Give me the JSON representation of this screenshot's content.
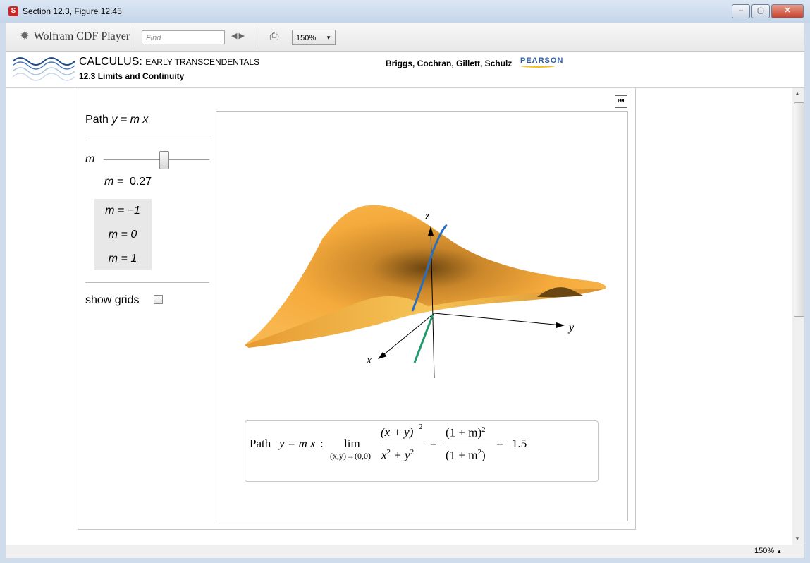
{
  "window": {
    "title": "Section 12.3, Figure 12.45",
    "minimize_icon": "minimize-icon",
    "maximize_icon": "maximize-icon",
    "close_icon": "close-icon"
  },
  "toolbar": {
    "app_name": "Wolfram CDF Player",
    "find_placeholder": "Find",
    "zoom": "150%"
  },
  "banner": {
    "book_title": "CALCULUS:",
    "book_subtitle": "EARLY TRANSCENDENTALS",
    "section": "12.3 Limits and Continuity",
    "authors": "Briggs, Cochran, Gillett, Schulz",
    "publisher": "PEARSON"
  },
  "controls": {
    "path_label": "Path",
    "path_expr": "y = m x",
    "slider_label": "m",
    "m_label": "m =",
    "m_value": "0.27",
    "m_slider_fraction": 0.57,
    "presets": [
      "m = −1",
      "m = 0",
      "m = 1"
    ],
    "show_grids_label": "show grids",
    "show_grids_checked": false
  },
  "plot": {
    "axis_x": "x",
    "axis_y": "y",
    "axis_z": "z",
    "surface_color": "#f5aa3c",
    "path_color": "#2a6fbf",
    "trace_color": "#1f9a6a"
  },
  "formula": {
    "prefix": "Path",
    "path": "y = m x",
    "colon": ":",
    "lim": "lim",
    "lim_sub": "(x,y)→(0,0)",
    "num1": "(x + y)",
    "num1_exp": "2",
    "den1_a": "x",
    "den1_b": " + y",
    "exp2": "2",
    "eq": "=",
    "num2": "(1 + m)",
    "den2": "(1 + m",
    "den2_close": ")",
    "result": "1.5"
  },
  "status": {
    "zoom": "150%"
  }
}
